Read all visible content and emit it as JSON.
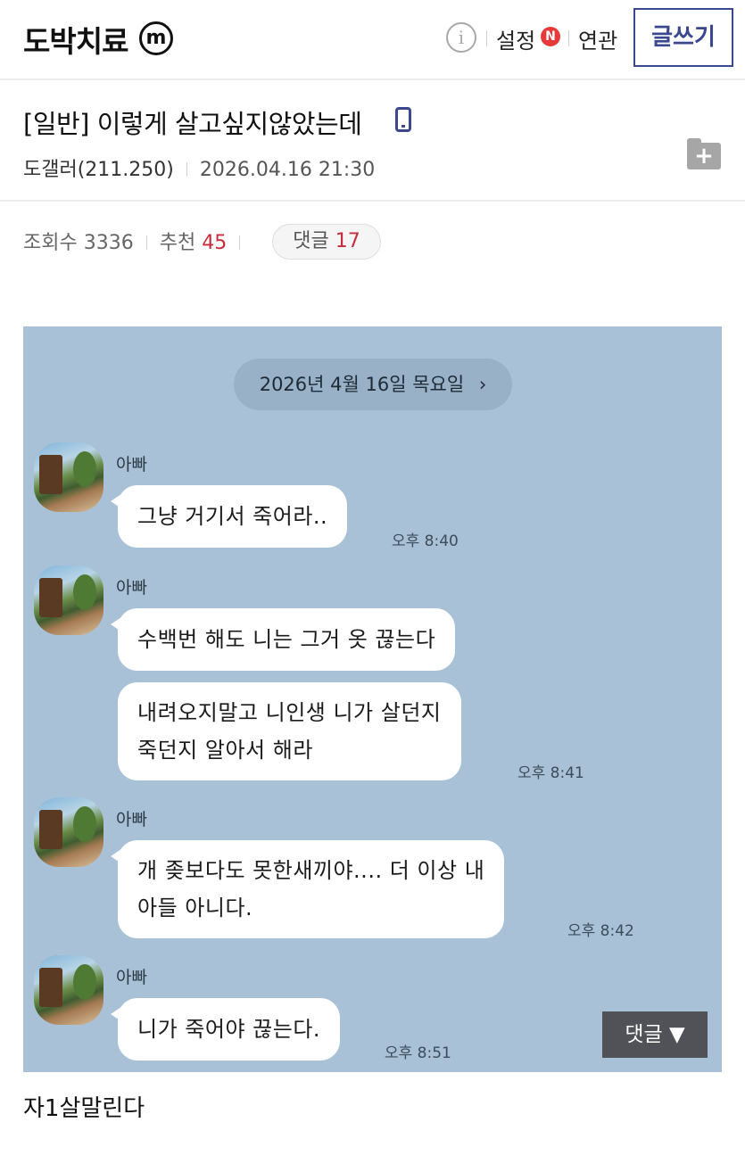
{
  "header": {
    "gallery_title": "도박치료",
    "mini_badge": "m",
    "info_icon": "info-icon",
    "settings_label": "설정",
    "settings_badge": "N",
    "related_label": "연관",
    "write_button": "글쓰기"
  },
  "post": {
    "title": "[일반] 이렇게 살고싶지않았는데",
    "title_icon": "mobile-phone-icon",
    "author": "도갤러(211.250)",
    "datetime": "2026.04.16 21:30",
    "folder_icon": "add-folder-icon"
  },
  "stats": {
    "views_label": "조회수",
    "views_value": "3336",
    "recommend_label": "추천",
    "recommend_value": "45",
    "comments_label": "댓글",
    "comments_value": "17"
  },
  "chat": {
    "date_label": "2026년 4월 16일 목요일",
    "date_chevron": "›",
    "groups": [
      {
        "sender": "아빠",
        "messages": [
          {
            "text": "그냥 거기서 죽어라.."
          }
        ],
        "time": "오후 8:40"
      },
      {
        "sender": "아빠",
        "messages": [
          {
            "text": "수백번 해도 니는 그거 옷 끊는다"
          },
          {
            "line1": "내려오지말고 니인생 니가 살던지",
            "line2": "죽던지 알아서 해라"
          }
        ],
        "time": "오후 8:41"
      },
      {
        "sender": "아빠",
        "messages": [
          {
            "line1": "개 좆보다도 못한새끼야....  더 이상 내",
            "line2": "아들 아니다."
          }
        ],
        "time": "오후 8:42"
      },
      {
        "sender": "아빠",
        "messages": [
          {
            "text": "니가 죽어야 끊는다."
          }
        ],
        "time": "오후 8:51"
      }
    ],
    "comment_button": "댓글 ▼"
  },
  "body": {
    "text": "자1살말린다"
  },
  "colors": {
    "brand_navy": "#3b4890",
    "recommend_red": "#c62c3a",
    "chat_background": "#a9c1d7",
    "n_badge": "#e63a3a"
  }
}
